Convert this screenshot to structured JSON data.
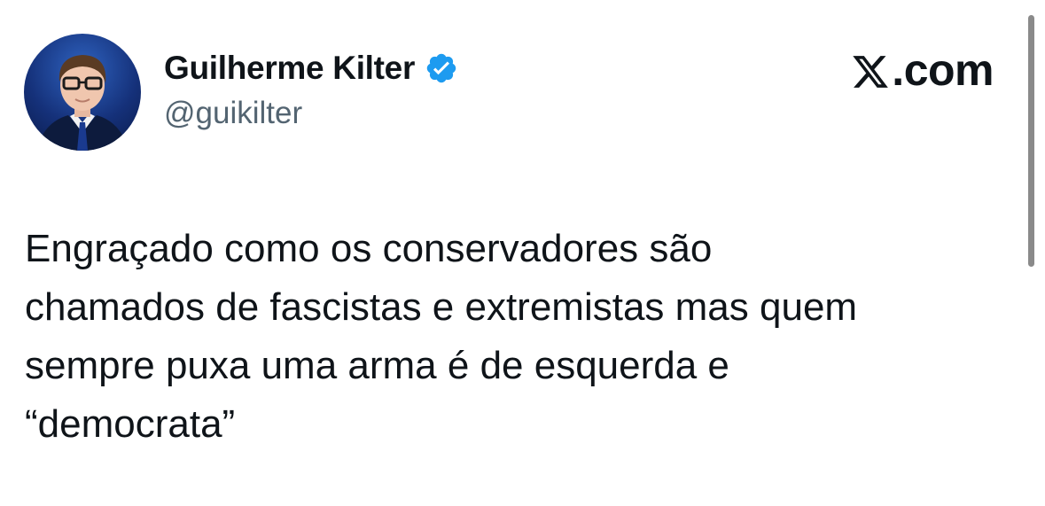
{
  "author": {
    "display_name": "Guilherme Kilter",
    "handle": "@guikilter",
    "verified": true,
    "avatar_icon": "profile-photo",
    "verified_icon": "verified-badge-icon",
    "verified_color": "#1d9bf0"
  },
  "brand": {
    "icon": "x-logo-icon",
    "label": ".com"
  },
  "tweet": {
    "lines": [
      "Engraçado como os conservadores são",
      "chamados de fascistas e extremistas mas quem",
      "sempre puxa uma arma é de esquerda e",
      "“democrata”"
    ]
  },
  "colors": {
    "text_primary": "#0f1419",
    "text_secondary": "#536471",
    "background": "#ffffff"
  }
}
